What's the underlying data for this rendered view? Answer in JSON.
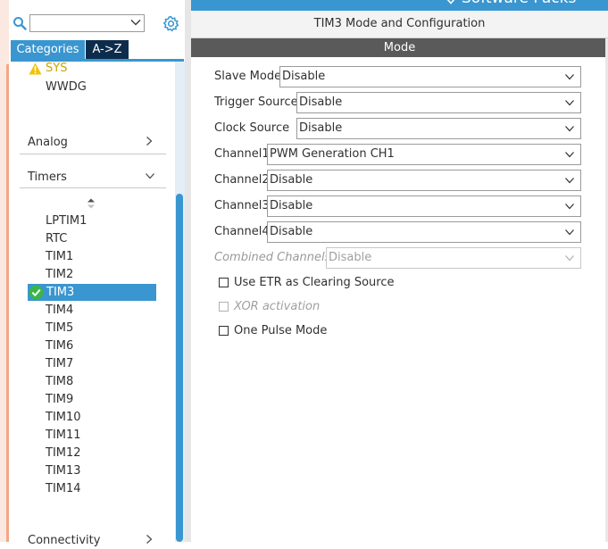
{
  "header": {
    "top_bar_label": "Software Packs",
    "config_title": "TIM3 Mode and Configuration",
    "mode_label": "Mode"
  },
  "sidebar": {
    "search": {
      "value": ""
    },
    "tabs": [
      {
        "label": "Categories",
        "active": true
      },
      {
        "label": "A->Z",
        "active": false
      }
    ],
    "items_above": [
      {
        "label": "SYS",
        "status": "warning"
      },
      {
        "label": "WWDG"
      }
    ],
    "categories": [
      {
        "label": "Analog",
        "expanded": false
      },
      {
        "label": "Timers",
        "expanded": true
      }
    ],
    "timers": [
      {
        "label": "LPTIM1"
      },
      {
        "label": "RTC"
      },
      {
        "label": "TIM1"
      },
      {
        "label": "TIM2"
      },
      {
        "label": "TIM3",
        "selected": true,
        "status": "configured"
      },
      {
        "label": "TIM4"
      },
      {
        "label": "TIM5"
      },
      {
        "label": "TIM6"
      },
      {
        "label": "TIM7"
      },
      {
        "label": "TIM8"
      },
      {
        "label": "TIM9"
      },
      {
        "label": "TIM10"
      },
      {
        "label": "TIM11"
      },
      {
        "label": "TIM12"
      },
      {
        "label": "TIM13"
      },
      {
        "label": "TIM14"
      }
    ],
    "partial_category": {
      "label": "Connectivity"
    }
  },
  "mode_fields": [
    {
      "label": "Slave Mode",
      "value": "Disable",
      "enabled": true
    },
    {
      "label": "Trigger Source",
      "value": "Disable",
      "enabled": true
    },
    {
      "label": "Clock Source",
      "value": "Disable",
      "enabled": true
    },
    {
      "label": "Channel1",
      "value": "PWM Generation CH1",
      "enabled": true
    },
    {
      "label": "Channel2",
      "value": "Disable",
      "enabled": true
    },
    {
      "label": "Channel3",
      "value": "Disable",
      "enabled": true
    },
    {
      "label": "Channel4",
      "value": "Disable",
      "enabled": true
    },
    {
      "label": "Combined Channels",
      "value": "Disable",
      "enabled": false
    }
  ],
  "mode_checkboxes": [
    {
      "label": "Use ETR as Clearing Source",
      "checked": false,
      "enabled": true
    },
    {
      "label": "XOR activation",
      "checked": false,
      "enabled": false
    },
    {
      "label": "One Pulse Mode",
      "checked": false,
      "enabled": true
    }
  ],
  "colors": {
    "accent": "#3a96d0",
    "tab_inactive": "#0d2c4c",
    "mode_bar": "#5a5a5a",
    "warning": "#f2c200",
    "warning_text": "#c8a400",
    "configured": "#3ab54a"
  },
  "icons": {
    "search": "search-icon",
    "settings": "gear-icon",
    "warning": "warning-icon",
    "configured": "check-circle-icon",
    "expand": "chevron-down-icon",
    "collapsed": "chevron-right-icon",
    "sort": "sort-icon"
  }
}
